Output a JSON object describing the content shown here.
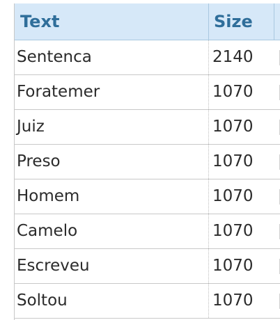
{
  "table": {
    "columns": [
      "Text",
      "Size"
    ],
    "rows": [
      {
        "text": "Sentenca",
        "size": "2140"
      },
      {
        "text": "Foratemer",
        "size": "1070"
      },
      {
        "text": "Juiz",
        "size": "1070"
      },
      {
        "text": "Preso",
        "size": "1070"
      },
      {
        "text": "Homem",
        "size": "1070"
      },
      {
        "text": "Camelo",
        "size": "1070"
      },
      {
        "text": "Escreveu",
        "size": "1070"
      },
      {
        "text": "Soltou",
        "size": "1070"
      }
    ]
  },
  "colors": {
    "header_bg": "#d6e8f8",
    "header_text": "#2f6e9a",
    "row_border": "#c8c8c8"
  }
}
